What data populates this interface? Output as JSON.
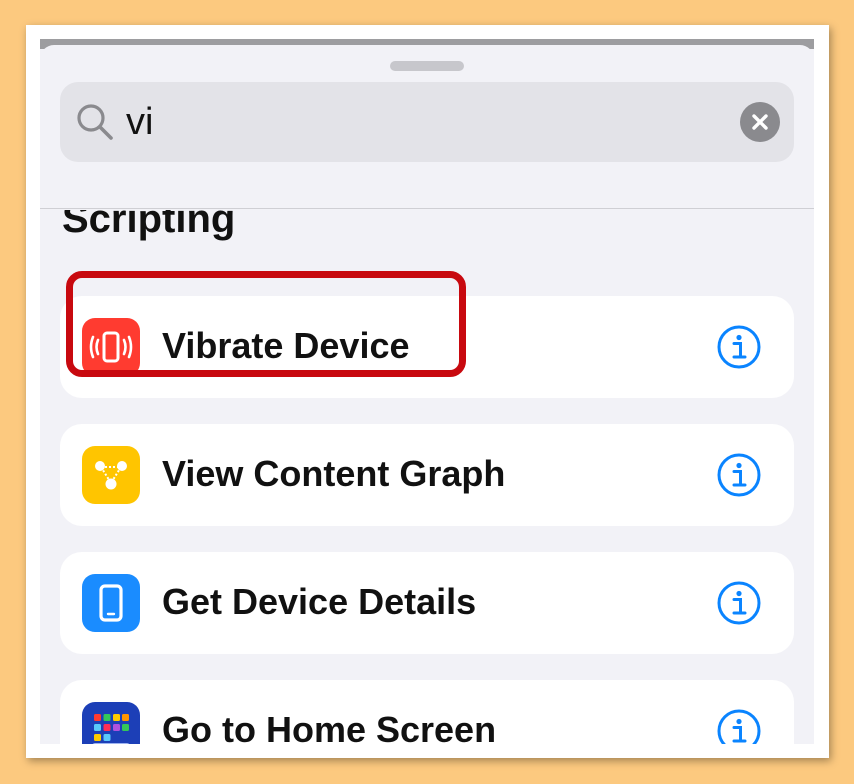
{
  "search": {
    "value": "vi",
    "placeholder": ""
  },
  "section": {
    "title": "Scripting"
  },
  "actions": [
    {
      "label": "Vibrate Device",
      "icon": "vibrate-phone-icon",
      "color": "#ff3b30"
    },
    {
      "label": "View Content Graph",
      "icon": "content-graph-icon",
      "color": "#ffcc00"
    },
    {
      "label": "Get Device Details",
      "icon": "phone-icon",
      "color": "#0a84ff"
    },
    {
      "label": "Go to Home Screen",
      "icon": "home-screen-icon",
      "color": "#1c3fb7"
    }
  ],
  "colors": {
    "accent": "#0a84ff",
    "highlight": "#c8090f",
    "background": "#fcc97f"
  }
}
